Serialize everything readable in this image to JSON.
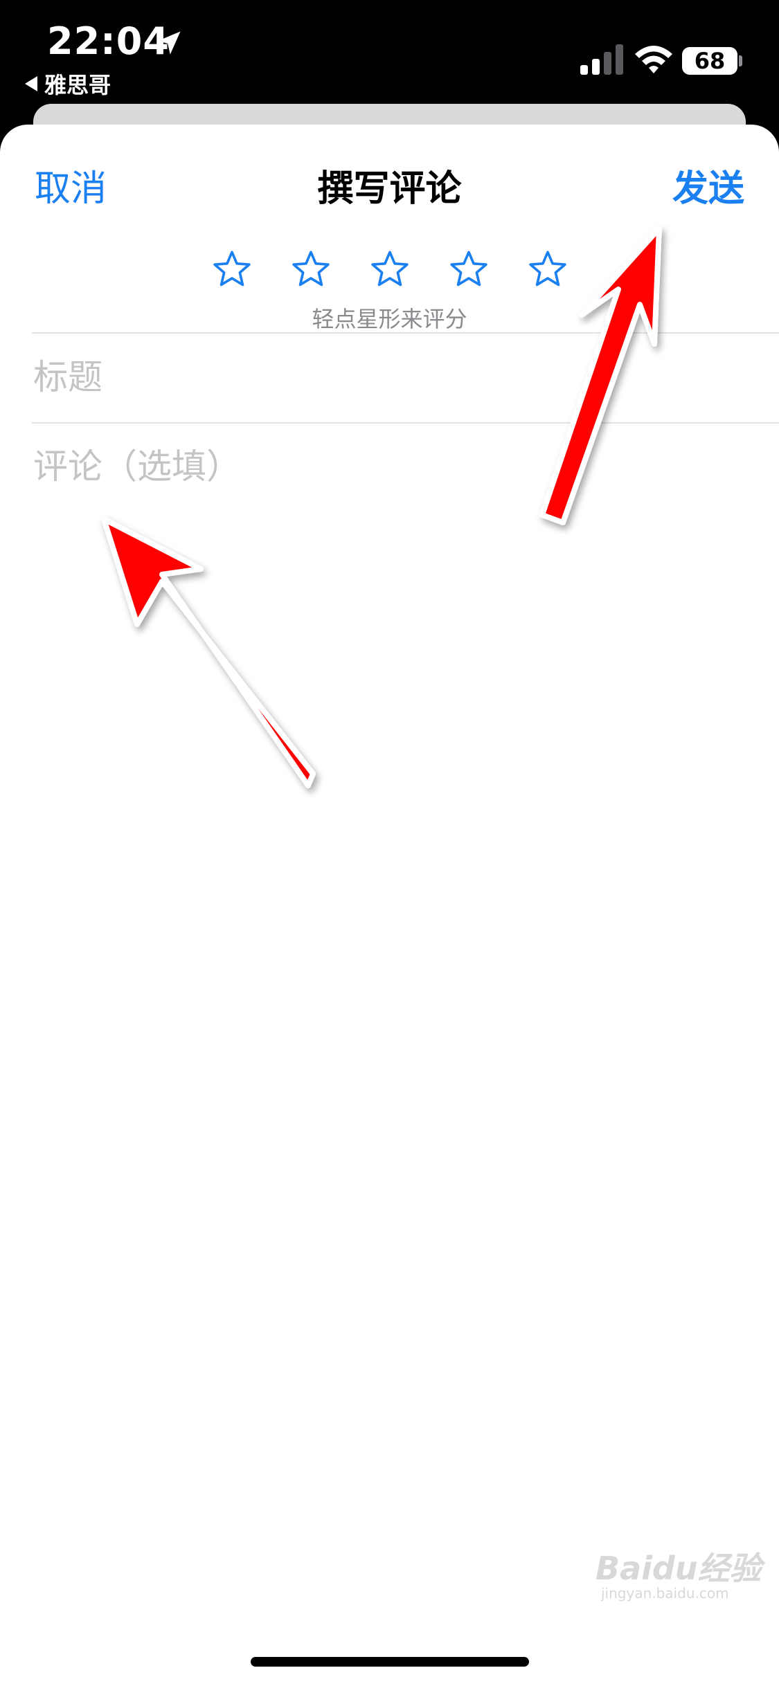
{
  "status_bar": {
    "time": "22:04",
    "back_app_label": "雅思哥",
    "battery_level": "68",
    "signal_bars": 2,
    "icons": [
      "location-arrow-icon",
      "cellular-signal-icon",
      "wifi-icon",
      "battery-icon"
    ]
  },
  "nav": {
    "cancel_label": "取消",
    "title": "撰写评论",
    "send_label": "发送"
  },
  "rating": {
    "star_count": 5,
    "selected": 0,
    "hint": "轻点星形来评分",
    "star_icon": "star-outline-icon"
  },
  "form": {
    "title_placeholder": "标题",
    "title_value": "",
    "review_placeholder": "评论（选填）",
    "review_value": ""
  },
  "annotations": {
    "arrow_color": "#ff0000",
    "count": 2
  },
  "watermark": {
    "text": "Baidu经验",
    "sub": "jingyan.baidu.com"
  },
  "colors": {
    "accent": "#1a7ff0",
    "placeholder": "#c4c4c7",
    "hint": "#8a8a8e"
  }
}
